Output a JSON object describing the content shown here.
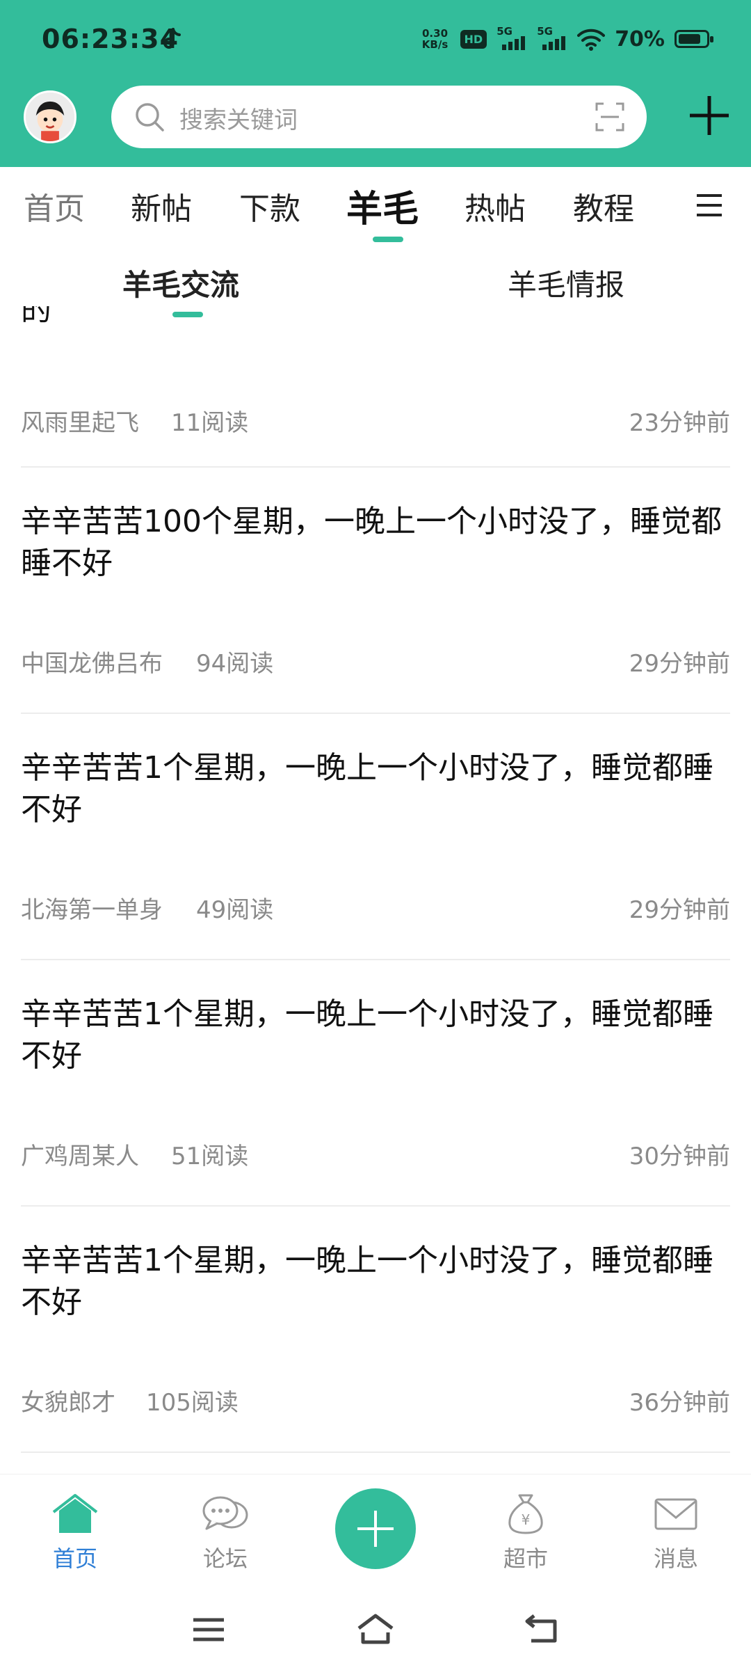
{
  "status_bar": {
    "time": "06:23:34",
    "net_speed_value": "0.30",
    "net_speed_unit": "KB/s",
    "hd_label": "HD",
    "signal_1_label": "5G",
    "signal_2_label": "5G",
    "battery_percent": "70%",
    "battery_level": 0.7
  },
  "search": {
    "placeholder": "搜索关键词"
  },
  "category_tabs": [
    {
      "label": "首页"
    },
    {
      "label": "新帖"
    },
    {
      "label": "下款"
    },
    {
      "label": "羊毛",
      "active": true
    },
    {
      "label": "热帖"
    },
    {
      "label": "教程"
    }
  ],
  "sub_tabs": [
    {
      "label": "羊毛交流",
      "active": true
    },
    {
      "label": "羊毛情报"
    }
  ],
  "feed": {
    "partial_title": "的",
    "first_meta": {
      "author": "风雨里起飞",
      "reads": "11阅读",
      "time": "23分钟前"
    },
    "posts": [
      {
        "title": "辛辛苦苦100个星期，一晚上一个小时没了，睡觉都睡不好",
        "author": "中国龙佛吕布",
        "reads": "94阅读",
        "time": "29分钟前"
      },
      {
        "title": "辛辛苦苦1个星期，一晚上一个小时没了，睡觉都睡不好",
        "author": "北海第一单身",
        "reads": "49阅读",
        "time": "29分钟前"
      },
      {
        "title": "辛辛苦苦1个星期，一晚上一个小时没了，睡觉都睡不好",
        "author": "广鸡周某人",
        "reads": "51阅读",
        "time": "30分钟前"
      },
      {
        "title": "辛辛苦苦1个星期，一晚上一个小时没了，睡觉都睡不好",
        "author": "女貌郎才",
        "reads": "105阅读",
        "time": "36分钟前"
      }
    ]
  },
  "bottom_nav": {
    "items": [
      {
        "label": "首页",
        "icon": "home-icon",
        "active": true
      },
      {
        "label": "论坛",
        "icon": "chat-bubbles-icon"
      },
      {
        "label": "超市",
        "icon": "money-bag-icon"
      },
      {
        "label": "消息",
        "icon": "envelope-icon"
      }
    ],
    "fab_icon": "plus-icon"
  },
  "colors": {
    "brand": "#33bd9b",
    "active_nav": "#2f7fd6",
    "muted_text": "#8a8a8a"
  }
}
